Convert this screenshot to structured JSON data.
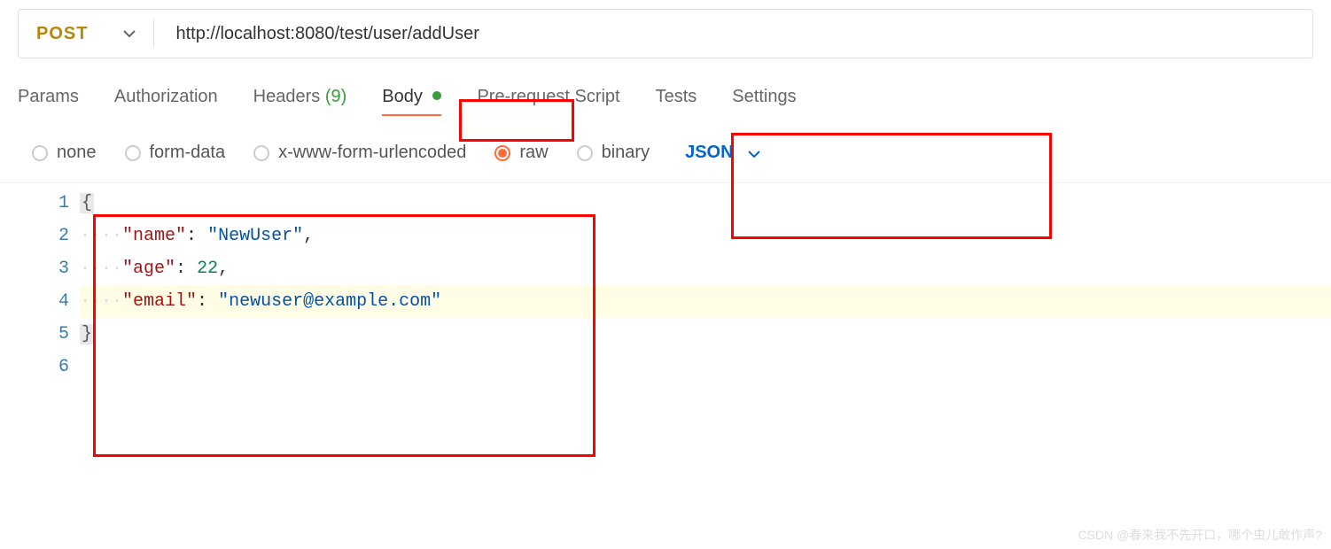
{
  "request": {
    "method": "POST",
    "url": "http://localhost:8080/test/user/addUser"
  },
  "tabs": {
    "params": "Params",
    "authorization": "Authorization",
    "headers": "Headers",
    "headersCount": "(9)",
    "body": "Body",
    "preRequest": "Pre-request Script",
    "tests": "Tests",
    "settings": "Settings"
  },
  "bodyOptions": {
    "none": "none",
    "formData": "form-data",
    "urlencoded": "x-www-form-urlencoded",
    "raw": "raw",
    "binary": "binary",
    "format": "JSON"
  },
  "code": {
    "ln1": "1",
    "ln2": "2",
    "ln3": "3",
    "ln4": "4",
    "ln5": "5",
    "ln6": "6",
    "brace_open": "{",
    "brace_close": "}",
    "indent": "····",
    "k_name": "\"name\"",
    "v_name": "\"NewUser\"",
    "k_age": "\"age\"",
    "v_age": "22",
    "k_email": "\"email\"",
    "v_email": "\"newuser@example.com\"",
    "colon": ":",
    "sp": " ",
    "comma": ","
  },
  "watermark": "CSDN @春来我不先开口，哪个虫儿敢作声?"
}
